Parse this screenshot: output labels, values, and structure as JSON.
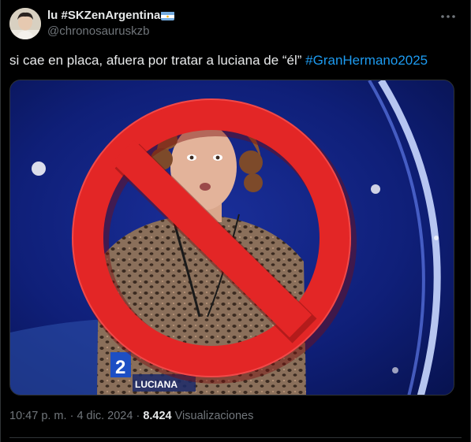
{
  "author": {
    "display_name": "lu #SKZenArgentina",
    "handle": "@chronosauruskzb",
    "flag_icon": "argentina-flag-icon"
  },
  "tweet": {
    "text_plain": "si cae en placa, afuera por tratar a luciana de “él” ",
    "hashtag": "#GranHermano2025"
  },
  "media": {
    "channel_number": "2",
    "lower_third_name": "LUCIANA",
    "overlay_icon": "prohibited-sign-icon"
  },
  "meta": {
    "time": "10:47 p. m.",
    "separator": "·",
    "date": "4 dic. 2024",
    "views_count": "8.424",
    "views_label": "Visualizaciones"
  },
  "colors": {
    "background": "#000000",
    "text": "#e7e9ea",
    "muted": "#71767b",
    "link": "#1d9bf0",
    "prohibition_red": "#e32626"
  }
}
